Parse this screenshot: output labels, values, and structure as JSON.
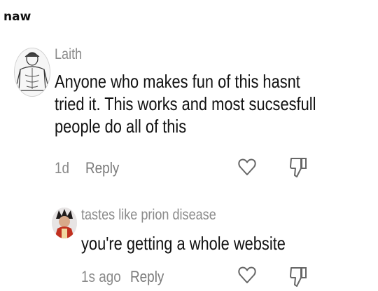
{
  "header": {
    "title": "naw"
  },
  "comments": [
    {
      "username": "Laith",
      "text": "Anyone who makes fun of this hasnt tried it. This works and most sucsesfull people do all of this",
      "time": "1d",
      "reply_label": "Reply",
      "icons": {
        "like": "heart-outline-icon",
        "dislike": "thumb-down-outline-icon"
      }
    },
    {
      "username": "tastes like prion disease",
      "text": "you're getting a whole website",
      "time": "1s ago",
      "reply_label": "Reply",
      "icons": {
        "like": "heart-outline-icon",
        "dislike": "thumb-down-outline-icon"
      }
    }
  ]
}
